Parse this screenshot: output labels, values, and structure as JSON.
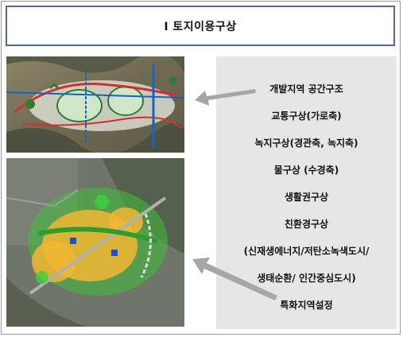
{
  "title": "Ⅰ 토지이용구상",
  "panel": {
    "items": [
      "개발지역 공간구조",
      "교통구상(가로축)",
      "녹지구상(경관축, 녹지축)",
      "물구상 (수경축)",
      "생활권구상",
      "친환경구상",
      "(신재생에너지/저탄소녹색도시/",
      "생태순환/ 인간중심도시)",
      "특화지역설정"
    ]
  },
  "colors": {
    "title_border": "#4f6b94",
    "panel_bg": "#e6e6e6",
    "arrow": "#a6a6a6"
  }
}
